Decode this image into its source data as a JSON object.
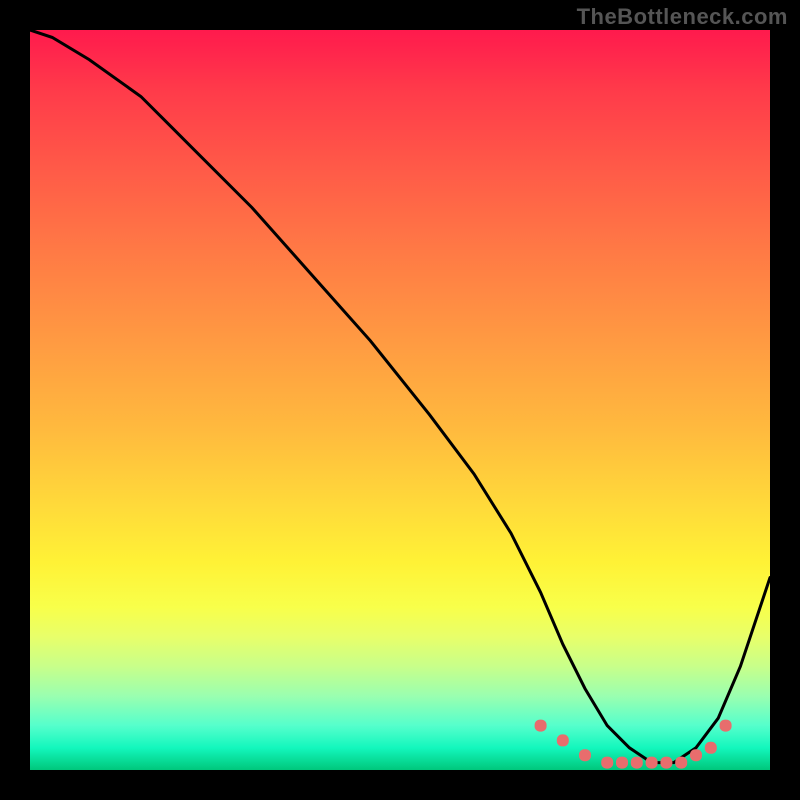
{
  "watermark": "TheBottleneck.com",
  "chart_data": {
    "type": "line",
    "title": "",
    "xlabel": "",
    "ylabel": "",
    "xlim": [
      0,
      100
    ],
    "ylim": [
      0,
      100
    ],
    "grid": false,
    "legend": false,
    "series": [
      {
        "name": "curve",
        "stroke": "#000000",
        "stroke_width": 3,
        "x": [
          0,
          3,
          8,
          15,
          22,
          30,
          38,
          46,
          54,
          60,
          65,
          69,
          72,
          75,
          78,
          81,
          84,
          87,
          90,
          93,
          96,
          100
        ],
        "y": [
          100,
          99,
          96,
          91,
          84,
          76,
          67,
          58,
          48,
          40,
          32,
          24,
          17,
          11,
          6,
          3,
          1,
          1,
          3,
          7,
          14,
          26
        ]
      }
    ],
    "markers": {
      "name": "bottom-dots",
      "shape": "rounded",
      "fill": "#e86d6d",
      "points": [
        {
          "x": 69,
          "y": 6,
          "r": 6
        },
        {
          "x": 72,
          "y": 4,
          "r": 6
        },
        {
          "x": 75,
          "y": 2,
          "r": 6
        },
        {
          "x": 78,
          "y": 1,
          "r": 6
        },
        {
          "x": 80,
          "y": 1,
          "r": 6
        },
        {
          "x": 82,
          "y": 1,
          "r": 6
        },
        {
          "x": 84,
          "y": 1,
          "r": 6
        },
        {
          "x": 86,
          "y": 1,
          "r": 6
        },
        {
          "x": 88,
          "y": 1,
          "r": 6
        },
        {
          "x": 90,
          "y": 2,
          "r": 6
        },
        {
          "x": 92,
          "y": 3,
          "r": 6
        },
        {
          "x": 94,
          "y": 6,
          "r": 6
        }
      ]
    },
    "background": {
      "type": "vertical-gradient",
      "stops": [
        {
          "pos": 0.0,
          "color": "#ff1a4d"
        },
        {
          "pos": 0.3,
          "color": "#ff7a45"
        },
        {
          "pos": 0.64,
          "color": "#ffd93a"
        },
        {
          "pos": 0.82,
          "color": "#e8ff6a"
        },
        {
          "pos": 0.97,
          "color": "#13f7bd"
        },
        {
          "pos": 1.0,
          "color": "#00c77b"
        }
      ]
    }
  }
}
